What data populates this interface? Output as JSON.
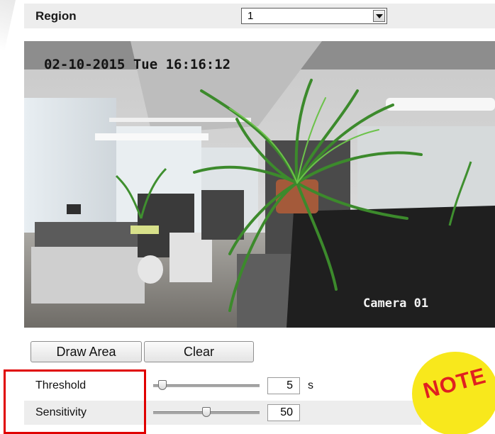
{
  "region": {
    "label": "Region",
    "selected_value": "1"
  },
  "video": {
    "osd_timestamp": "02-10-2015 Tue 16:16:12",
    "osd_camera_name": "Camera 01"
  },
  "buttons": {
    "draw_area": "Draw Area",
    "clear": "Clear"
  },
  "params": {
    "threshold": {
      "label": "Threshold",
      "value": "5",
      "unit": "s",
      "slider_fraction": 0.05
    },
    "sensitivity": {
      "label": "Sensitivity",
      "value": "50",
      "slider_fraction": 0.5
    }
  },
  "note": {
    "text": "NOTE"
  },
  "colors": {
    "highlight": "#e00000",
    "note_badge": "#f8e81c",
    "note_text": "#e02020",
    "row_background": "#ededed"
  },
  "icons": {
    "select_arrow": "chevron-down-icon"
  }
}
